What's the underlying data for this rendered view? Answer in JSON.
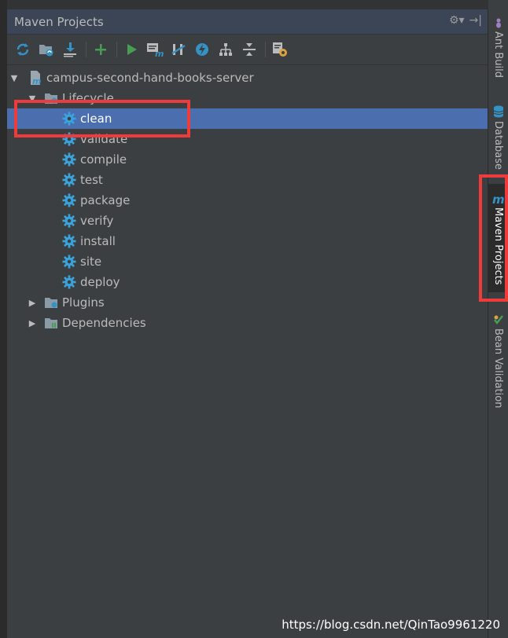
{
  "panel": {
    "title": "Maven Projects",
    "header_actions": {
      "settings_glyph": "⚙▾",
      "hide_glyph": "→|"
    }
  },
  "toolbar": {
    "buttons": [
      {
        "icon": "reimport-icon",
        "color": "#3592c4"
      },
      {
        "icon": "generate-sources-icon",
        "color": "#3592c4"
      },
      {
        "icon": "download-icon",
        "color": "#3592c4"
      },
      {
        "icon": "add-icon",
        "color": "#499c54"
      },
      {
        "icon": "run-icon",
        "color": "#499c54"
      },
      {
        "icon": "execute-goal-icon",
        "color": "#3592c4"
      },
      {
        "icon": "toggle-offline-icon",
        "color": "#3592c4"
      },
      {
        "icon": "skip-tests-icon",
        "color": "#3592c4"
      },
      {
        "icon": "show-dependencies-icon",
        "color": "#bbbbbb"
      },
      {
        "icon": "collapse-all-icon",
        "color": "#bbbbbb"
      },
      {
        "icon": "maven-settings-icon",
        "color": "#d9a343"
      }
    ]
  },
  "tree": {
    "project": "campus-second-hand-books-server",
    "lifecycle_label": "Lifecycle",
    "lifecycle_goals": [
      "clean",
      "validate",
      "compile",
      "test",
      "package",
      "verify",
      "install",
      "site",
      "deploy"
    ],
    "selected_goal": "clean",
    "plugins_label": "Plugins",
    "dependencies_label": "Dependencies"
  },
  "right_tabs": [
    {
      "label": "Ant Build",
      "icon": "ant-icon"
    },
    {
      "label": "Database",
      "icon": "database-icon"
    },
    {
      "label": "Maven Projects",
      "icon": "maven-icon",
      "active": true
    },
    {
      "label": "Bean Validation",
      "icon": "bean-validation-icon"
    }
  ],
  "watermark": "https://blog.csdn.net/QinTao9961220",
  "colors": {
    "selection": "#4b6eaf",
    "highlight_box": "#ef3b3b",
    "gear": "#3aa3dc"
  }
}
